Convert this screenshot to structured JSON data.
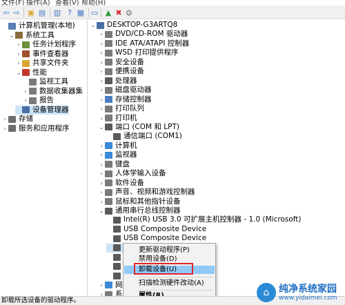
{
  "menubar": {
    "items": [
      "文件(F)",
      "操作(A)",
      "查看(V)",
      "帮助(H)"
    ]
  },
  "toolbar": {
    "buttons": [
      {
        "name": "back-icon",
        "glyph": "⇦",
        "color": "#3b7bd4"
      },
      {
        "name": "forward-icon",
        "glyph": "⇨",
        "color": "#3b7bd4"
      },
      {
        "name": "up-folder-icon",
        "glyph": "▣",
        "color": "#d9a632"
      },
      {
        "name": "show-hide-tree-icon",
        "glyph": "▤",
        "color": "#4a7bc4"
      },
      {
        "name": "properties-icon",
        "glyph": "▥",
        "color": "#4a7bc4"
      },
      {
        "name": "help-icon",
        "glyph": "?",
        "color": "#2f6fc0"
      },
      {
        "name": "list-view-icon",
        "glyph": "▦",
        "color": "#4a7bc4"
      },
      {
        "name": "monitor-icon",
        "glyph": "▭",
        "color": "#2f6fc0"
      },
      {
        "name": "update-driver-icon",
        "glyph": "▲",
        "color": "#2e9b3a"
      },
      {
        "name": "uninstall-icon",
        "glyph": "✖",
        "color": "#d8262b"
      },
      {
        "name": "enable-icon",
        "glyph": "⊙",
        "color": "#333333"
      }
    ]
  },
  "left_tree": [
    {
      "label": "计算机管理(本地)",
      "level": 0,
      "arrow": "",
      "icon": "#5a7fb5"
    },
    {
      "label": "系统工具",
      "level": 1,
      "arrow": "⌄",
      "icon": "#8a6d3b"
    },
    {
      "label": "任务计划程序",
      "level": 2,
      "arrow": "›",
      "icon": "#6b8f3a"
    },
    {
      "label": "事件查看器",
      "level": 2,
      "arrow": "›",
      "icon": "#a0522d"
    },
    {
      "label": "共享文件夹",
      "level": 2,
      "arrow": "›",
      "icon": "#d9a632"
    },
    {
      "label": "性能",
      "level": 2,
      "arrow": "⌄",
      "icon": "#c0392b"
    },
    {
      "label": "监视工具",
      "level": 3,
      "arrow": "",
      "icon": "#7a7a7a"
    },
    {
      "label": "数据收集器集",
      "level": 3,
      "arrow": "›",
      "icon": "#7a7a7a"
    },
    {
      "label": "报告",
      "level": 3,
      "arrow": "›",
      "icon": "#7a7a7a"
    },
    {
      "label": "设备管理器",
      "level": 2,
      "arrow": "",
      "icon": "#4a6fa5",
      "selected": true
    },
    {
      "label": "存储",
      "level": 0,
      "arrow": "›",
      "icon": "#6d6d6d"
    },
    {
      "label": "服务和应用程序",
      "level": 0,
      "arrow": "›",
      "icon": "#6d6d6d"
    }
  ],
  "device_tree": [
    {
      "label": "DESKTOP-G3ARTQ8",
      "level": 0,
      "arrow": "⌄",
      "icon": "#4a6fa5"
    },
    {
      "label": "DVD/CD-ROM 驱动器",
      "level": 1,
      "arrow": "›",
      "icon": "#7a7a7a"
    },
    {
      "label": "IDE ATA/ATAPI 控制器",
      "level": 1,
      "arrow": "›",
      "icon": "#7a7a7a"
    },
    {
      "label": "WSD 打印提供程序",
      "level": 1,
      "arrow": "›",
      "icon": "#7a7a7a"
    },
    {
      "label": "安全设备",
      "level": 1,
      "arrow": "›",
      "icon": "#7a7a7a"
    },
    {
      "label": "便携设备",
      "level": 1,
      "arrow": "›",
      "icon": "#7a7a7a"
    },
    {
      "label": "处理器",
      "level": 1,
      "arrow": "›",
      "icon": "#5a5a5a"
    },
    {
      "label": "磁盘驱动器",
      "level": 1,
      "arrow": "›",
      "icon": "#7a7a7a"
    },
    {
      "label": "存储控制器",
      "level": 1,
      "arrow": "›",
      "icon": "#4a7bc4"
    },
    {
      "label": "打印队列",
      "level": 1,
      "arrow": "›",
      "icon": "#7a7a7a"
    },
    {
      "label": "打印机",
      "level": 1,
      "arrow": "›",
      "icon": "#7a7a7a"
    },
    {
      "label": "端口 (COM 和 LPT)",
      "level": 1,
      "arrow": "⌄",
      "icon": "#5a5a5a"
    },
    {
      "label": "通信端口 (COM1)",
      "level": 2,
      "arrow": "",
      "icon": "#5a5a5a"
    },
    {
      "label": "计算机",
      "level": 1,
      "arrow": "›",
      "icon": "#3b8ad9"
    },
    {
      "label": "监视器",
      "level": 1,
      "arrow": "›",
      "icon": "#3b8ad9"
    },
    {
      "label": "键盘",
      "level": 1,
      "arrow": "›",
      "icon": "#7a7a7a"
    },
    {
      "label": "人体学输入设备",
      "level": 1,
      "arrow": "›",
      "icon": "#7a7a7a"
    },
    {
      "label": "软件设备",
      "level": 1,
      "arrow": "›",
      "icon": "#7a7a7a"
    },
    {
      "label": "声音、视频和游戏控制器",
      "level": 1,
      "arrow": "›",
      "icon": "#7a7a7a"
    },
    {
      "label": "鼠标和其他指针设备",
      "level": 1,
      "arrow": "›",
      "icon": "#7a7a7a"
    },
    {
      "label": "通用串行总线控制器",
      "level": 1,
      "arrow": "⌄",
      "icon": "#5a5a5a"
    },
    {
      "label": "Intel(R) USB 3.0 可扩展主机控制器 - 1.0 (Microsoft)",
      "level": 2,
      "arrow": "",
      "icon": "#5a5a5a"
    },
    {
      "label": "USB Composite Device",
      "level": 2,
      "arrow": "",
      "icon": "#5a5a5a"
    },
    {
      "label": "USB Composite Device",
      "level": 2,
      "arrow": "",
      "icon": "#5a5a5a"
    },
    {
      "label": "USB 大容量存储设备",
      "level": 2,
      "arrow": "",
      "icon": "#5a5a5a",
      "selected": true
    },
    {
      "label": "",
      "level": 2,
      "arrow": "",
      "icon": "#5a5a5a"
    },
    {
      "label": "",
      "level": 2,
      "arrow": "",
      "icon": "#5a5a5a"
    },
    {
      "label": "",
      "level": 2,
      "arrow": "",
      "icon": "#5a5a5a"
    },
    {
      "label": "网",
      "level": 1,
      "arrow": "›",
      "icon": "#3b8ad9"
    },
    {
      "label": "系",
      "level": 1,
      "arrow": "›",
      "icon": "#7a7a7a"
    }
  ],
  "context_menu": {
    "items": [
      {
        "label": "更新驱动程序(P)",
        "highlighted": false
      },
      {
        "label": "禁用设备(D)",
        "highlighted": false
      },
      {
        "label": "卸载设备(U)",
        "highlighted": true
      },
      {
        "label": "扫描检测硬件改动(A)",
        "highlighted": false
      },
      {
        "label": "属性(R)",
        "highlighted": false,
        "bold": true
      }
    ],
    "highlight_color": "#91c9f7",
    "annotation_color": "#e0262b"
  },
  "statusbar": {
    "text": "卸载所选设备的驱动程序。"
  },
  "watermark": {
    "title": "纯净系统家园",
    "url": "www.yidaimei.com"
  }
}
